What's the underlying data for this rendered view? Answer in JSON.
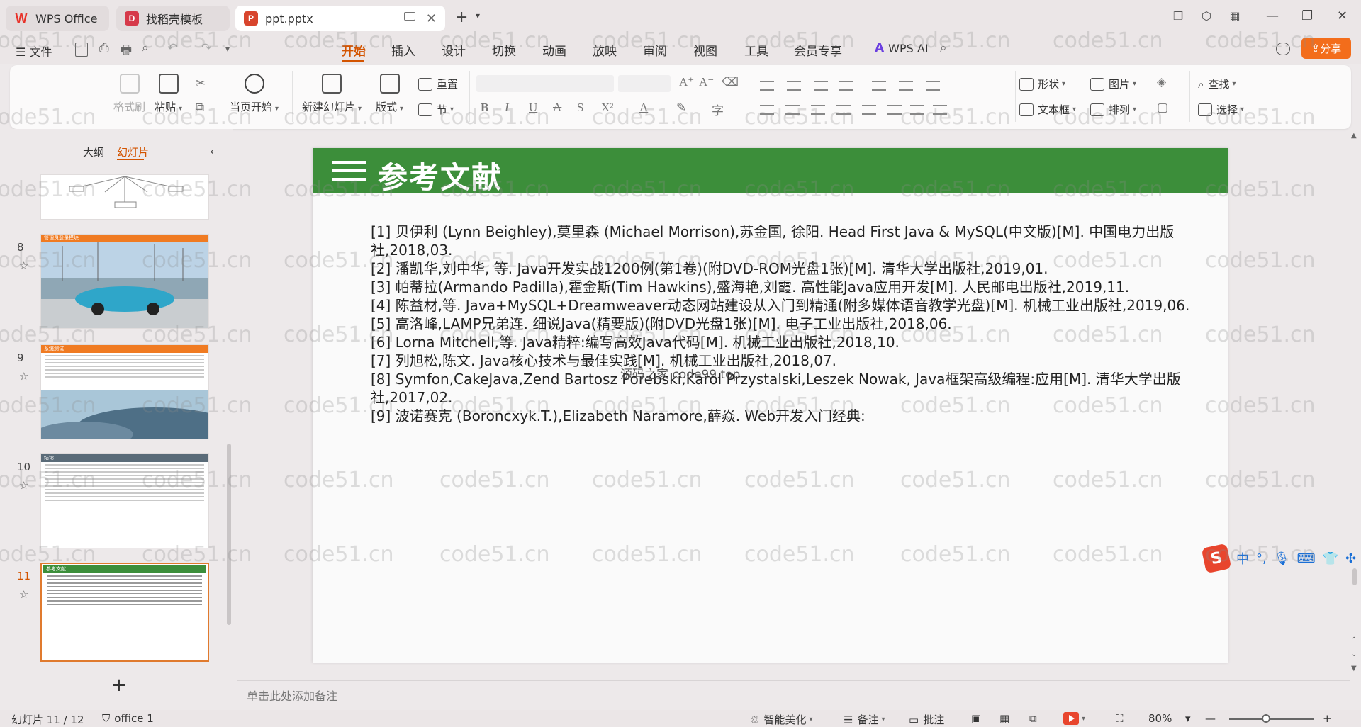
{
  "tabs": [
    {
      "label": "WPS Office",
      "icon": "wps-logo-icon"
    },
    {
      "label": "找稻壳模板",
      "icon": "docer-icon"
    },
    {
      "label": "ppt.pptx",
      "icon": "presentation-file-icon",
      "active": true
    }
  ],
  "menu": {
    "file": "文件",
    "ribbon_tabs": [
      "开始",
      "插入",
      "设计",
      "切换",
      "动画",
      "放映",
      "审阅",
      "视图",
      "工具",
      "会员专享"
    ],
    "active_tab": "开始",
    "wps_ai": "WPS AI",
    "share": "分享"
  },
  "ribbon": {
    "format_painter": "格式刷",
    "paste": "粘贴",
    "from_current": "当页开始",
    "new_slide": "新建幻灯片",
    "layout": "版式",
    "reset": "重置",
    "section": "节",
    "shape": "形状",
    "picture": "图片",
    "textbox": "文本框",
    "arrange": "排列",
    "find": "查找",
    "select": "选择"
  },
  "left_panel": {
    "outline_tab": "大纲",
    "slides_tab": "幻灯片",
    "thumbnails": [
      {
        "number": "8",
        "title": "管理员登录模块"
      },
      {
        "number": "9",
        "title": "系统测试"
      },
      {
        "number": "10",
        "title": "结论"
      },
      {
        "number": "11",
        "title": "参考文献",
        "selected": true
      }
    ]
  },
  "slide": {
    "title": "参考文献",
    "header_color": "#3c8e3a",
    "references": [
      "[1] 贝伊利 (Lynn Beighley),莫里森 (Michael Morrison),苏金国, 徐阳. Head First Java & MySQL(中文版)[M]. 中国电力出版社,2018,03.",
      "[2] 潘凯华,刘中华, 等. Java开发实战1200例(第1卷)(附DVD-ROM光盘1张)[M].  清华大学出版社,2019,01.",
      "[3] 帕蒂拉(Armando Padilla),霍金斯(Tim Hawkins),盛海艳,刘霞. 高性能Java应用开发[M]. 人民邮电出版社,2019,11.",
      "[4] 陈益材,等. Java+MySQL+Dreamweaver动态网站建设从入门到精通(附多媒体语音教学光盘)[M]. 机械工业出版社,2019,06.",
      "[5] 高洛峰,LAMP兄弟连. 细说Java(精要版)(附DVD光盘1张)[M]. 电子工业出版社,2018,06.",
      "[6] Lorna Mitchell,等. Java精粹:编写高效Java代码[M]. 机械工业出版社,2018,10.",
      "[7] 列旭松,陈文. Java核心技术与最佳实践[M]. 机械工业出版社,2018,07.",
      "[8] Symfon,CakeJava,Zend Bartosz Porebski,Karol Przystalski,Leszek Nowak, Java框架高级编程:应用[M]. 清华大学出版社,2017,02.",
      "[9] 波诺赛克 (Boroncxyk.T.),Elizabeth Naramore,薛焱. Web开发入门经典:"
    ],
    "overlay_watermark": "源码之家 code99.top"
  },
  "notes_placeholder": "单击此处添加备注",
  "status": {
    "slide_counter": "幻灯片 11 / 12",
    "theme": "office 1",
    "beautify": "智能美化",
    "notes": "备注",
    "comments": "批注",
    "zoom": "80%"
  },
  "ime": {
    "lang": "中"
  },
  "watermark": "code51.cn",
  "accent_color": "#d35400"
}
